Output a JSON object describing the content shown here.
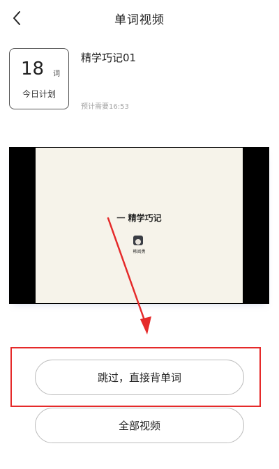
{
  "header": {
    "title": "单词视频"
  },
  "plan": {
    "count": "18",
    "unit": "词",
    "label": "今日计划"
  },
  "course": {
    "title": "精学巧记01",
    "eta": "预计需要16:53"
  },
  "video": {
    "heading": "一 精学巧记",
    "author": "韩阅勇"
  },
  "buttons": {
    "skip_label": "跳过，直接背单词",
    "all_label": "全部视频"
  },
  "colors": {
    "annotation": "#e52a2a",
    "video_background": "#000000",
    "video_frame": "#f6f3ea"
  },
  "icons": {
    "back": "chevron-left-icon"
  }
}
